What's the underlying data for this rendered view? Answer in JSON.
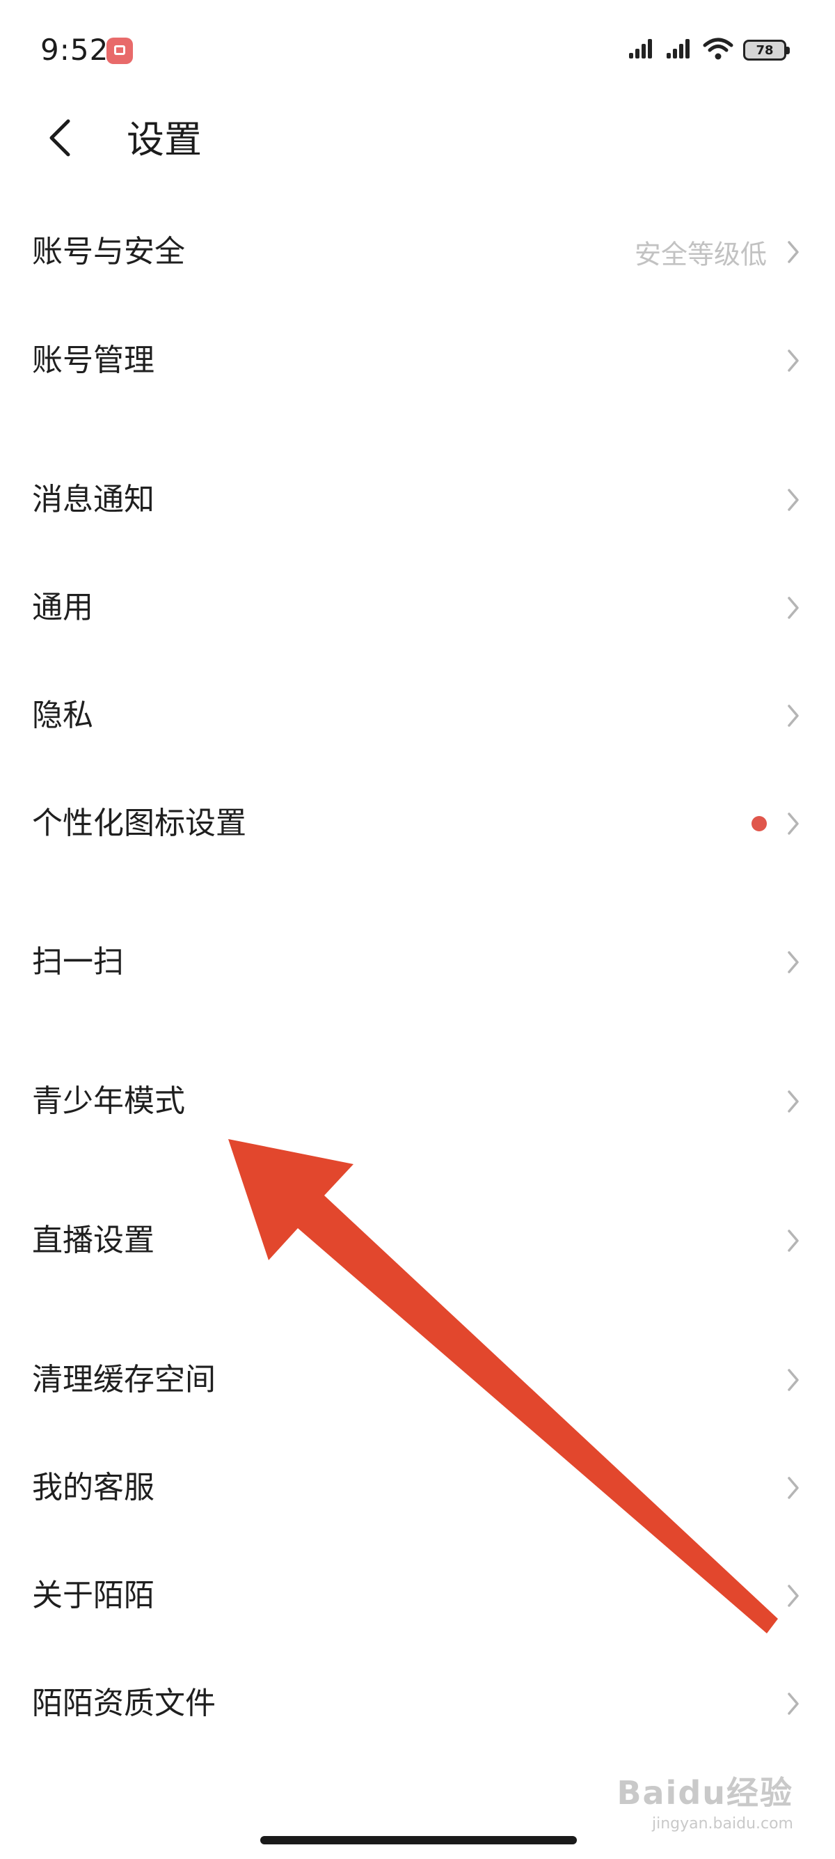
{
  "status_bar": {
    "time": "9:52",
    "battery": "78",
    "icons": [
      "signal-icon",
      "signal-icon",
      "wifi-icon",
      "battery-icon"
    ]
  },
  "header": {
    "title": "设置",
    "back_icon": "chevron-left-icon"
  },
  "settings": [
    {
      "label": "账号与安全",
      "value": "安全等级低"
    },
    {
      "label": "账号管理"
    },
    {
      "label": "消息通知"
    },
    {
      "label": "通用"
    },
    {
      "label": "隐私"
    },
    {
      "label": "个性化图标设置",
      "badge": "red-dot"
    },
    {
      "label": "扫一扫"
    },
    {
      "label": "青少年模式"
    },
    {
      "label": "直播设置"
    },
    {
      "label": "清理缓存空间"
    },
    {
      "label": "我的客服"
    },
    {
      "label": "关于陌陌"
    },
    {
      "label": "陌陌资质文件"
    }
  ],
  "colors": {
    "accent_red": "#e0564b",
    "annotation_arrow": "#e2472d",
    "secondary_text": "#c2c2c2",
    "chevron": "#b5b5b5"
  },
  "watermark": {
    "logo": "Baidu经验",
    "url": "jingyan.baidu.com"
  }
}
